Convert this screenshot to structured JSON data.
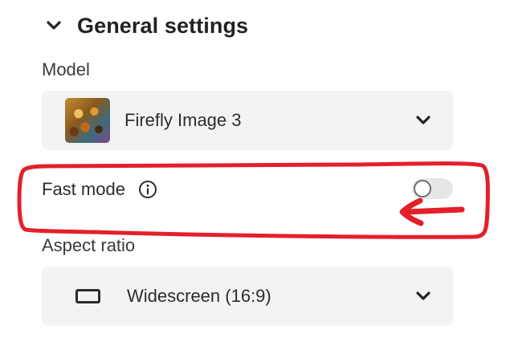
{
  "section": {
    "title": "General settings",
    "expanded_icon": "chevron-down-icon"
  },
  "model": {
    "label": "Model",
    "selected": "Firefly Image 3",
    "thumbnail": "leopard-thumbnail"
  },
  "fast_mode": {
    "label": "Fast mode",
    "info_icon": "info-icon",
    "enabled": false
  },
  "aspect_ratio": {
    "label": "Aspect ratio",
    "selected": "Widescreen (16:9)",
    "icon": "widescreen-icon"
  },
  "annotation": {
    "color": "#e3202a"
  }
}
